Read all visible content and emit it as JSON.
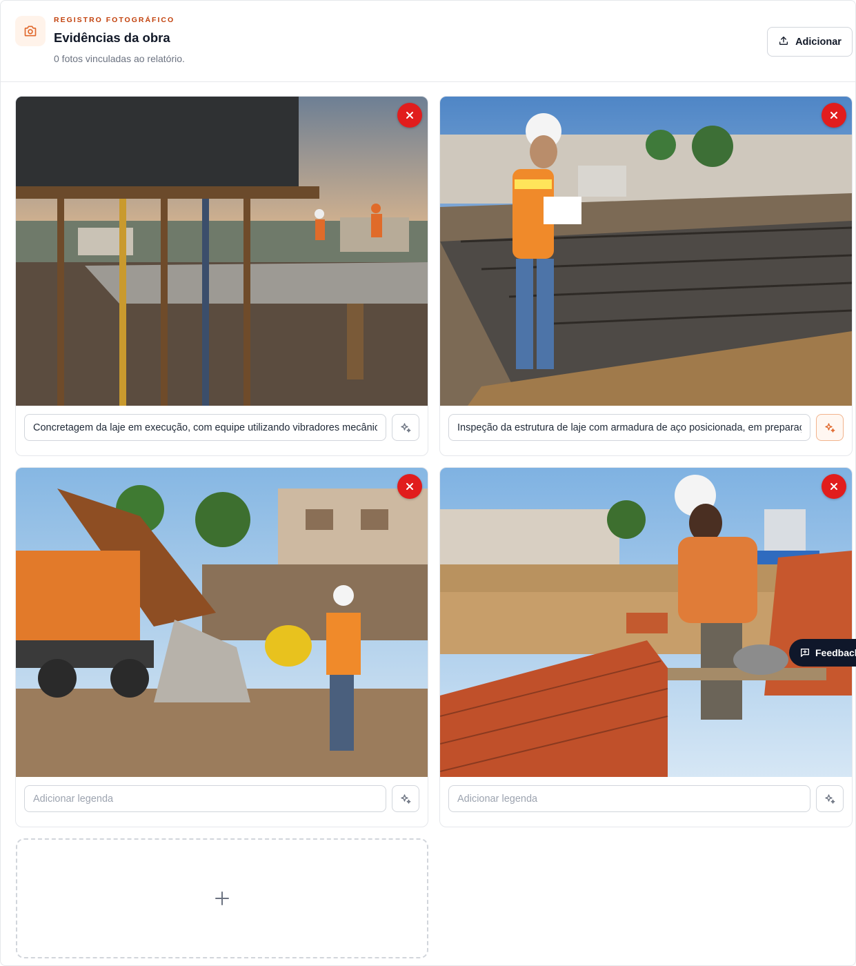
{
  "header": {
    "icon": "camera-icon",
    "eyebrow": "REGISTRO FOTOGRÁFICO",
    "title": "Evidências da obra",
    "subtitle": "0 fotos vinculadas ao relatório.",
    "add_button_label": "Adicionar",
    "add_button_icon": "upload-icon"
  },
  "photos": [
    {
      "scene": "laje-concretagem",
      "caption": "Concretagem da laje em execução, com equipe utilizando vibradores mecânicos",
      "caption_placeholder": "Adicionar legenda"
    },
    {
      "scene": "inspecao-armadura",
      "caption": "Inspeção da estrutura de laje com armadura de aço posicionada, em preparação",
      "caption_placeholder": "Adicionar legenda"
    },
    {
      "scene": "caminhao-betoneira",
      "caption": "",
      "caption_placeholder": "Adicionar legenda"
    },
    {
      "scene": "alvenaria-tijolos",
      "caption": "",
      "caption_placeholder": "Adicionar legenda"
    }
  ],
  "icons": {
    "remove": "close-icon",
    "ai": "sparkles-icon",
    "add": "plus-icon",
    "feedback": "message-plus-icon"
  },
  "feedback": {
    "label": "Feedback"
  },
  "colors": {
    "accent": "#c2410c",
    "danger": "#e11d1d",
    "dark": "#0f172a",
    "border": "#e5e7eb"
  }
}
